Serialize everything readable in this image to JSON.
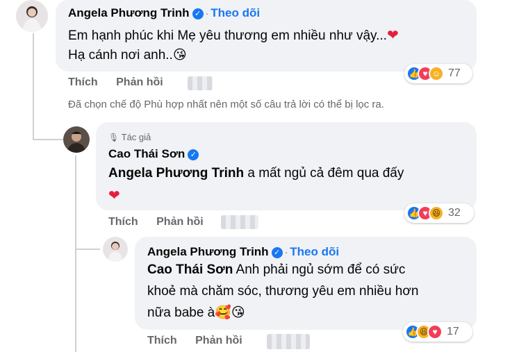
{
  "comment1": {
    "author": "Angela Phương Trinh",
    "follow": "Theo dõi",
    "line1": "Em hạnh phúc khi Mẹ yêu thương em nhiều như vậy...",
    "line2": "Hạ cánh nơi anh..",
    "line2_emoji": "😘",
    "reaction_count": "77",
    "reaction_icons": [
      "like-icon",
      "love-icon",
      "care-icon"
    ]
  },
  "actions": {
    "like": "Thích",
    "reply": "Phản hồi"
  },
  "filter_notice": "Đã chọn chế độ Phù hợp nhất nên một số câu trả lời có thể bị lọc ra.",
  "reply1": {
    "badge": "Tác giả",
    "author": "Cao Thái Sơn",
    "mention": "Angela Phương Trinh",
    "text": " a mất ngủ cả đêm qua đấy",
    "reaction_count": "32",
    "reaction_icons": [
      "like-icon",
      "love-icon",
      "haha-icon"
    ]
  },
  "reply2": {
    "author": "Angela Phương Trinh",
    "follow": "Theo dõi",
    "mention": "Cao Thái Sơn",
    "line1": " Anh phải ngủ sớm để có sức",
    "line2": "khoẻ mà chăm sóc, thương yêu em nhiều hơn",
    "line3": "nữa babe à",
    "line3_emoji": "🥰😘",
    "reaction_count": "17",
    "reaction_icons": [
      "like-icon",
      "haha-icon",
      "love-icon"
    ]
  },
  "colors": {
    "accent": "#1877f2",
    "bubble": "#f0f2f5",
    "secondary_text": "#65676b",
    "heart": "#e41e3f"
  }
}
